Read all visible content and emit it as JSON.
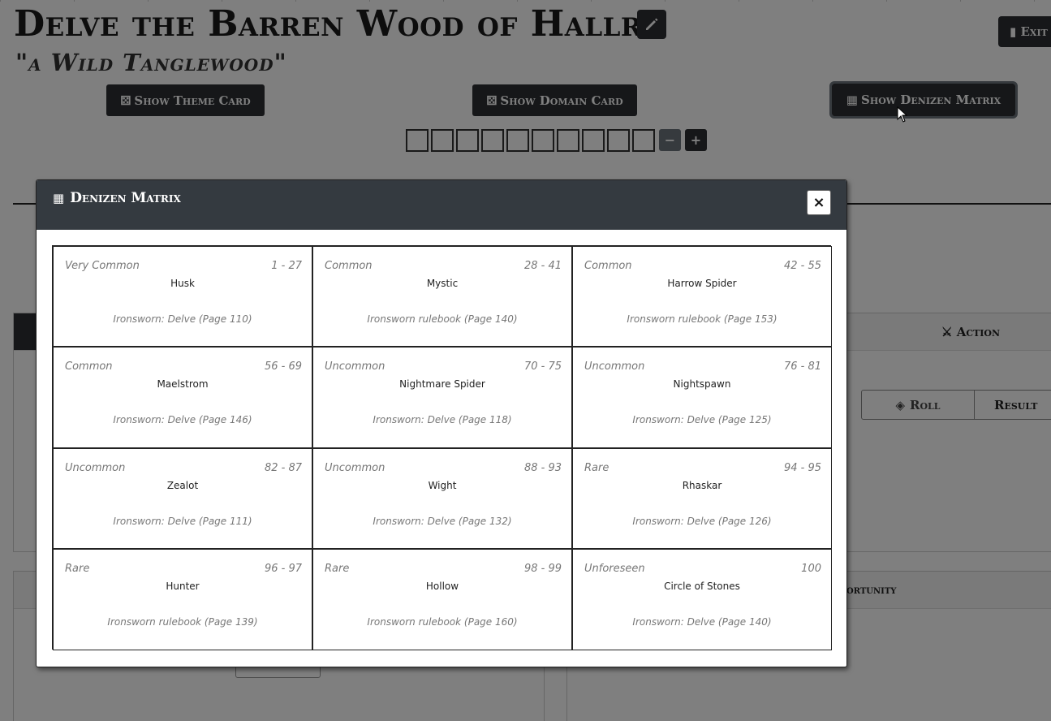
{
  "page": {
    "title": "Delve the Barren Wood of Hallr",
    "subtitle": "\"a Wild Tanglewood\"",
    "exit_label": "Exit",
    "buttons": {
      "theme": "Show Theme Card",
      "domain": "Show Domain Card",
      "denizen": "Show Denizen Matrix"
    },
    "progress_ticks": 10,
    "minus_label": "−",
    "plus_label": "+",
    "action_label": "Action",
    "roll_label": "Roll",
    "result_label": "Result",
    "opportunity_label": "ortunity"
  },
  "modal": {
    "title": "Denizen Matrix",
    "close_label": "×",
    "cells": [
      {
        "frequency": "Very Common",
        "range": "1 - 27",
        "name": "Husk",
        "source": "Ironsworn: Delve (Page 110)"
      },
      {
        "frequency": "Common",
        "range": "28 - 41",
        "name": "Mystic",
        "source": "Ironsworn rulebook (Page 140)"
      },
      {
        "frequency": "Common",
        "range": "42 - 55",
        "name": "Harrow Spider",
        "source": "Ironsworn rulebook (Page 153)"
      },
      {
        "frequency": "Common",
        "range": "56 - 69",
        "name": "Maelstrom",
        "source": "Ironsworn: Delve (Page 146)"
      },
      {
        "frequency": "Uncommon",
        "range": "70 - 75",
        "name": "Nightmare Spider",
        "source": "Ironsworn: Delve (Page 118)"
      },
      {
        "frequency": "Uncommon",
        "range": "76 - 81",
        "name": "Nightspawn",
        "source": "Ironsworn: Delve (Page 125)"
      },
      {
        "frequency": "Uncommon",
        "range": "82 - 87",
        "name": "Zealot",
        "source": "Ironsworn: Delve (Page 111)"
      },
      {
        "frequency": "Uncommon",
        "range": "88 - 93",
        "name": "Wight",
        "source": "Ironsworn: Delve (Page 132)"
      },
      {
        "frequency": "Rare",
        "range": "94 - 95",
        "name": "Rhaskar",
        "source": "Ironsworn: Delve (Page 126)"
      },
      {
        "frequency": "Rare",
        "range": "96 - 97",
        "name": "Hunter",
        "source": "Ironsworn rulebook (Page 139)"
      },
      {
        "frequency": "Rare",
        "range": "98 - 99",
        "name": "Hollow",
        "source": "Ironsworn rulebook (Page 160)"
      },
      {
        "frequency": "Unforeseen",
        "range": "100",
        "name": "Circle of Stones",
        "source": "Ironsworn: Delve (Page 140)"
      }
    ]
  },
  "colors": {
    "dark": "#343a40",
    "button_dark": "#2c2f33",
    "backdrop": "rgba(0,0,0,0.5)"
  }
}
